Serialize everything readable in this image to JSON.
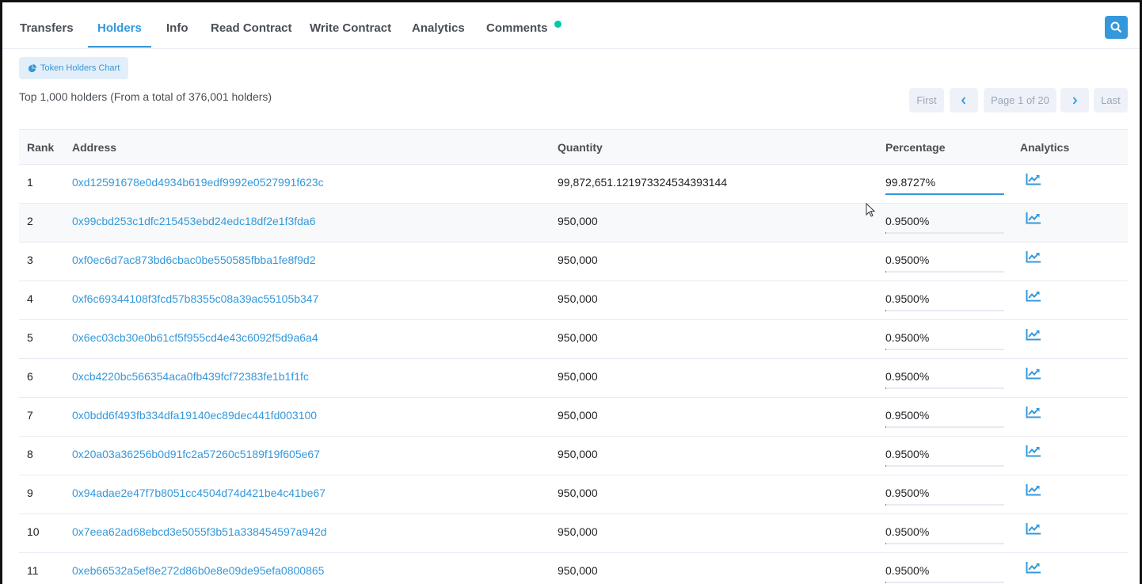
{
  "tabs": [
    {
      "label": "Transfers",
      "active": false
    },
    {
      "label": "Holders",
      "active": true
    },
    {
      "label": "Info",
      "active": false
    },
    {
      "label": "Read Contract",
      "active": false
    },
    {
      "label": "Write Contract",
      "active": false
    },
    {
      "label": "Analytics",
      "active": false
    },
    {
      "label": "Comments",
      "active": false
    }
  ],
  "search_icon": "search-icon",
  "chart_button": {
    "label": "Token Holders Chart",
    "icon": "pie-chart-icon"
  },
  "summary": "Top 1,000 holders (From a total of 376,001 holders)",
  "pagination": {
    "first": "First",
    "prev_icon": "chevron-left-icon",
    "page": "Page 1 of 20",
    "next_icon": "chevron-right-icon",
    "last": "Last"
  },
  "table": {
    "headers": {
      "rank": "Rank",
      "address": "Address",
      "quantity": "Quantity",
      "percentage": "Percentage",
      "analytics": "Analytics"
    },
    "analytics_icon": "trend-chart-icon",
    "accent_color": "#3498db",
    "rows": [
      {
        "rank": "1",
        "address": "0xd12591678e0d4934b619edf9992e0527991f623c",
        "quantity": "99,872,651.121973324534393144",
        "percentage": "99.8727%",
        "share": 0.998727
      },
      {
        "rank": "2",
        "address": "0x99cbd253c1dfc215453ebd24edc18df2e1f3fda6",
        "quantity": "950,000",
        "percentage": "0.9500%",
        "share": 0.0095
      },
      {
        "rank": "3",
        "address": "0xf0ec6d7ac873bd6cbac0be550585fbba1fe8f9d2",
        "quantity": "950,000",
        "percentage": "0.9500%",
        "share": 0.0095
      },
      {
        "rank": "4",
        "address": "0xf6c69344108f3fcd57b8355c08a39ac55105b347",
        "quantity": "950,000",
        "percentage": "0.9500%",
        "share": 0.0095
      },
      {
        "rank": "5",
        "address": "0x6ec03cb30e0b61cf5f955cd4e43c6092f5d9a6a4",
        "quantity": "950,000",
        "percentage": "0.9500%",
        "share": 0.0095
      },
      {
        "rank": "6",
        "address": "0xcb4220bc566354aca0fb439fcf72383fe1b1f1fc",
        "quantity": "950,000",
        "percentage": "0.9500%",
        "share": 0.0095
      },
      {
        "rank": "7",
        "address": "0x0bdd6f493fb334dfa19140ec89dec441fd003100",
        "quantity": "950,000",
        "percentage": "0.9500%",
        "share": 0.0095
      },
      {
        "rank": "8",
        "address": "0x20a03a36256b0d91fc2a57260c5189f19f605e67",
        "quantity": "950,000",
        "percentage": "0.9500%",
        "share": 0.0095
      },
      {
        "rank": "9",
        "address": "0x94adae2e47f7b8051cc4504d74d421be4c41be67",
        "quantity": "950,000",
        "percentage": "0.9500%",
        "share": 0.0095
      },
      {
        "rank": "10",
        "address": "0x7eea62ad68ebcd3e5055f3b51a338454597a942d",
        "quantity": "950,000",
        "percentage": "0.9500%",
        "share": 0.0095
      },
      {
        "rank": "11",
        "address": "0xeb66532a5ef8e272d86b0e8e09de95efa0800865",
        "quantity": "950,000",
        "percentage": "0.9500%",
        "share": 0.0095
      }
    ]
  }
}
